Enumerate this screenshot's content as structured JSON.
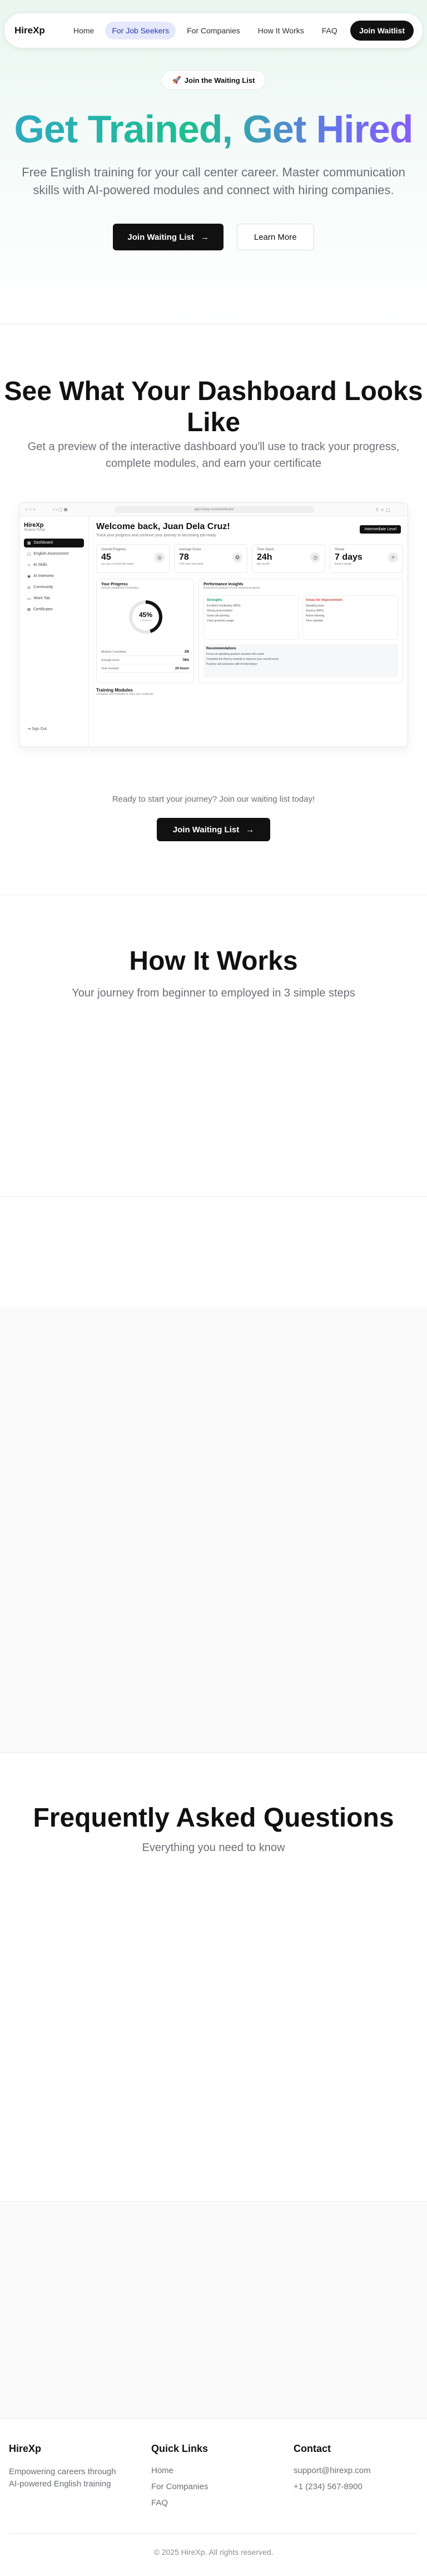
{
  "nav": {
    "logo": "HireXp",
    "links": [
      "Home",
      "For Job Seekers",
      "For Companies",
      "How It Works",
      "FAQ"
    ],
    "cta": "Join Waitlist"
  },
  "hero": {
    "badge": "Join the Waiting List",
    "title": "Get Trained, Get Hired",
    "subtitle": "Free English training for your call center career. Master communication skills with AI-powered modules and connect with hiring companies.",
    "primary_btn": "Join Waiting List",
    "secondary_btn": "Learn More"
  },
  "dashboard_section": {
    "title": "See What Your Dashboard Looks Like",
    "subtitle": "Get a preview of the interactive dashboard you'll use to track your progress, complete modules, and earn your certificate"
  },
  "dashboard": {
    "url": "app.hirexp.com/dashboard",
    "logo": "HireXp",
    "logo_sub": "Student Portal",
    "nav": [
      "Dashboard",
      "English Assessment",
      "AI Skills",
      "AI Interview",
      "Community",
      "Work Tab",
      "Certificates"
    ],
    "logout": "Sign Out",
    "welcome": "Welcome back, Juan Dela Cruz!",
    "welcome_sub": "Track your progress and continue your journey to becoming job-ready",
    "level": "Intermediate Level",
    "stats": [
      {
        "label": "Overall Progress",
        "value": "45",
        "note": "you are on track this week"
      },
      {
        "label": "Average Score",
        "value": "78",
        "note": "+5% from last week"
      },
      {
        "label": "Time Spent",
        "value": "24h",
        "note": "this month"
      },
      {
        "label": "Streak",
        "value": "7 days",
        "note": "Keep it going!"
      }
    ],
    "progress": {
      "title": "Your Progress",
      "sub": "Overall completion of modules",
      "percent": "45%",
      "percent_label": "Completed",
      "rows": [
        {
          "label": "Modules Completed",
          "value": "3/8"
        },
        {
          "label": "Average Score",
          "value": "78%"
        },
        {
          "label": "Time Invested",
          "value": "24 hours"
        }
      ]
    },
    "insights": {
      "title": "Performance Insights",
      "sub": "AI-powered analysis of your learning progress",
      "strengths_title": "Strengths",
      "strengths": [
        "Excellent vocabulary (85%)",
        "Strong pronunciation",
        "Good call opening",
        "Clear grammar usage"
      ],
      "improve_title": "Areas for Improvement",
      "improve": [
        "Speaking pace",
        "Fluency (68%)",
        "Active listening",
        "Tone variation"
      ],
      "recs_title": "Recommendations",
      "recs": [
        "Focus on speaking practice sessions this week",
        "Complete the fluency module to improve your overall score",
        "Practice call scenarios with AI interviewer"
      ]
    },
    "modules_title": "Training Modules",
    "modules_sub": "Complete all 8 modules to earn your certificate"
  },
  "cta": {
    "text": "Ready to start your journey? Join our waiting list today!",
    "button": "Join Waiting List"
  },
  "how": {
    "title": "How It Works",
    "subtitle": "Your journey from beginner to employed in 3 simple steps"
  },
  "faq": {
    "title": "Frequently Asked Questions",
    "subtitle": "Everything you need to know"
  },
  "footer": {
    "brand": "HireXp",
    "desc": "Empowering careers through AI-powered English training",
    "links_title": "Quick Links",
    "links": [
      "Home",
      "For Companies",
      "FAQ"
    ],
    "contact_title": "Contact",
    "email": "support@hirexp.com",
    "phone": "+1 (234) 567-8900",
    "copyright": "© 2025 HireXp. All rights reserved."
  }
}
